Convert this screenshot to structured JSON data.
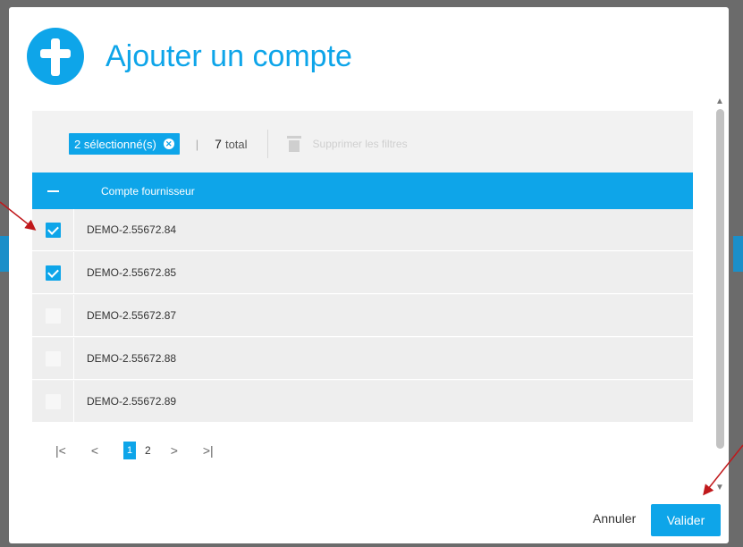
{
  "dialog": {
    "title": "Ajouter un compte",
    "icon": "add-cross-icon",
    "accent_color": "#0ea5e9"
  },
  "filters": {
    "selected_label": "2 sélectionné(s)",
    "separator": "|",
    "total_count": "7",
    "total_label": "total",
    "clear_filters_label": "Supprimer les filtres"
  },
  "table": {
    "column_header": "Compte fournisseur",
    "rows": [
      {
        "account": "DEMO-2.55672.84",
        "checked": true
      },
      {
        "account": "DEMO-2.55672.85",
        "checked": true
      },
      {
        "account": "DEMO-2.55672.87",
        "checked": false
      },
      {
        "account": "DEMO-2.55672.88",
        "checked": false
      },
      {
        "account": "DEMO-2.55672.89",
        "checked": false
      }
    ]
  },
  "pagination": {
    "first": "|<",
    "prev": "<",
    "pages": [
      "1",
      "2"
    ],
    "current_page": "1",
    "next": ">",
    "last": ">|"
  },
  "footer": {
    "cancel_label": "Annuler",
    "submit_label": "Valider"
  }
}
